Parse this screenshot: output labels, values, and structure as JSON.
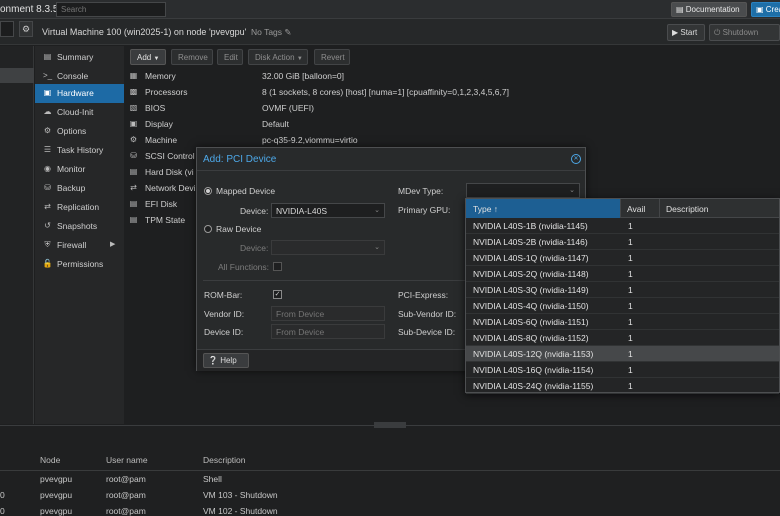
{
  "header": {
    "app_title": "onment 8.3.5",
    "search_placeholder": "Search",
    "documentation": "Documentation",
    "create_vm": "Crea"
  },
  "vm_bar": {
    "title": "Virtual Machine 100 (win2025-1) on node 'pvevgpu'",
    "tags": "No Tags",
    "start": "Start",
    "shutdown": "Shutdown"
  },
  "nav": {
    "items": [
      {
        "label": "Summary",
        "icon": "summary-icon"
      },
      {
        "label": "Console",
        "icon": "console-icon"
      },
      {
        "label": "Hardware",
        "icon": "hardware-icon",
        "active": true
      },
      {
        "label": "Cloud-Init",
        "icon": "cloud-icon"
      },
      {
        "label": "Options",
        "icon": "gear-icon"
      },
      {
        "label": "Task History",
        "icon": "list-icon"
      },
      {
        "label": "Monitor",
        "icon": "eye-icon"
      },
      {
        "label": "Backup",
        "icon": "backup-icon"
      },
      {
        "label": "Replication",
        "icon": "retweet-icon"
      },
      {
        "label": "Snapshots",
        "icon": "history-icon"
      },
      {
        "label": "Firewall",
        "icon": "shield-icon",
        "arrow": true
      },
      {
        "label": "Permissions",
        "icon": "unlock-icon"
      }
    ]
  },
  "hw_toolbar": {
    "add": "Add",
    "remove": "Remove",
    "edit": "Edit",
    "disk_action": "Disk Action",
    "revert": "Revert"
  },
  "hardware": [
    {
      "name": "Memory",
      "value": "32.00 GiB [balloon=0]",
      "icon": "memory-icon"
    },
    {
      "name": "Processors",
      "value": "8 (1 sockets, 8 cores) [host] [numa=1] [cpuaffinity=0,1,2,3,4,5,6,7]",
      "icon": "cpu-icon"
    },
    {
      "name": "BIOS",
      "value": "OVMF (UEFI)",
      "icon": "microchip-icon"
    },
    {
      "name": "Display",
      "value": "Default",
      "icon": "desktop-icon"
    },
    {
      "name": "Machine",
      "value": "pc-q35-9.2,viommu=virtio",
      "icon": "cogs-icon"
    },
    {
      "name": "SCSI Control",
      "value": "",
      "icon": "database-icon"
    },
    {
      "name": "Hard Disk (vi",
      "value": "",
      "icon": "hdd-icon"
    },
    {
      "name": "Network Devi",
      "value": "",
      "icon": "network-icon"
    },
    {
      "name": "EFI Disk",
      "value": "",
      "icon": "hdd-icon"
    },
    {
      "name": "TPM State",
      "value": "",
      "icon": "hdd-icon"
    }
  ],
  "dialog": {
    "title": "Add: PCI Device",
    "mapped_device": "Mapped Device",
    "device_label": "Device:",
    "device_value": "NVIDIA-L40S",
    "raw_device": "Raw Device",
    "raw_device_label": "Device:",
    "all_functions": "All Functions:",
    "mdev_type": "MDev Type:",
    "primary_gpu": "Primary GPU:",
    "rom_bar": "ROM-Bar:",
    "pci_express": "PCI-Express:",
    "vendor_id": "Vendor ID:",
    "vendor_placeholder": "From Device",
    "sub_vendor_id": "Sub-Vendor ID:",
    "device_id": "Device ID:",
    "device_placeholder": "From Device",
    "sub_device_id": "Sub-Device ID:",
    "help": "Help"
  },
  "mdev_list": {
    "columns": {
      "type": "Type ↑",
      "avail": "Avail",
      "description": "Description"
    },
    "rows": [
      {
        "type": "NVIDIA L40S-1B (nvidia-1145)",
        "avail": "1"
      },
      {
        "type": "NVIDIA L40S-2B (nvidia-1146)",
        "avail": "1"
      },
      {
        "type": "NVIDIA L40S-1Q (nvidia-1147)",
        "avail": "1"
      },
      {
        "type": "NVIDIA L40S-2Q (nvidia-1148)",
        "avail": "1"
      },
      {
        "type": "NVIDIA L40S-3Q (nvidia-1149)",
        "avail": "1"
      },
      {
        "type": "NVIDIA L40S-4Q (nvidia-1150)",
        "avail": "1"
      },
      {
        "type": "NVIDIA L40S-6Q (nvidia-1151)",
        "avail": "1"
      },
      {
        "type": "NVIDIA L40S-8Q (nvidia-1152)",
        "avail": "1"
      },
      {
        "type": "NVIDIA L40S-12Q (nvidia-1153)",
        "avail": "1",
        "selected": true
      },
      {
        "type": "NVIDIA L40S-16Q (nvidia-1154)",
        "avail": "1"
      },
      {
        "type": "NVIDIA L40S-24Q (nvidia-1155)",
        "avail": "1"
      }
    ]
  },
  "task_log": {
    "columns": {
      "node": "Node",
      "user": "User name",
      "description": "Description"
    },
    "rows": [
      {
        "lead": "",
        "node": "pvevgpu",
        "user": "root@pam",
        "description": "Shell"
      },
      {
        "lead": "0",
        "node": "pvevgpu",
        "user": "root@pam",
        "description": "VM 103 - Shutdown"
      },
      {
        "lead": "0",
        "node": "pvevgpu",
        "user": "root@pam",
        "description": "VM 102 - Shutdown"
      }
    ]
  }
}
